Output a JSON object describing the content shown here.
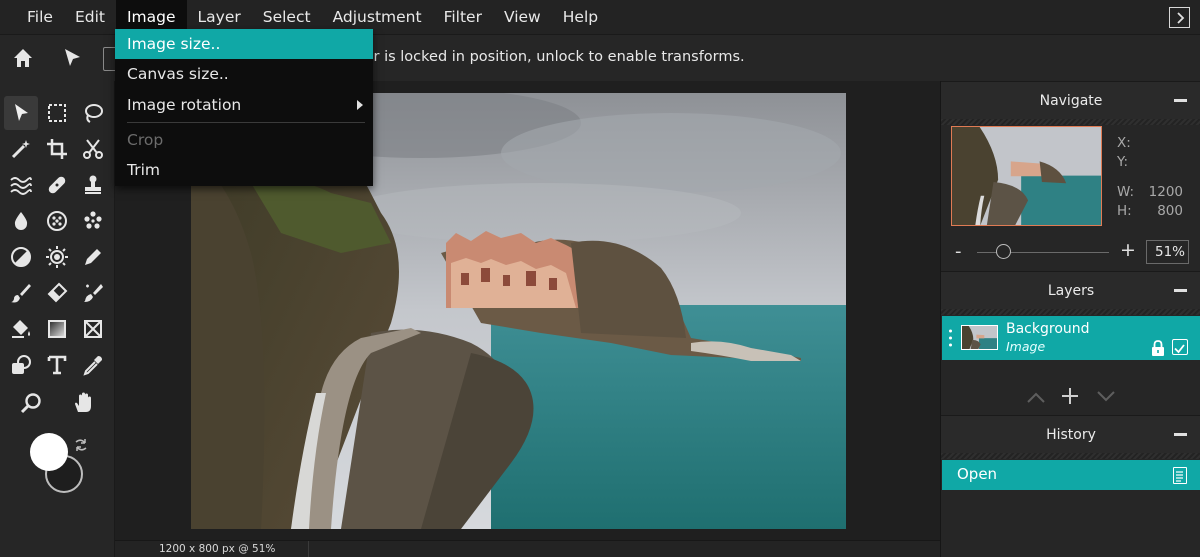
{
  "menu": {
    "items": [
      "File",
      "Edit",
      "Image",
      "Layer",
      "Select",
      "Adjustment",
      "Filter",
      "View",
      "Help"
    ],
    "active": "Image"
  },
  "image_menu": {
    "items": [
      {
        "label": "Image size..",
        "state": "highlighted"
      },
      {
        "label": "Canvas size..",
        "state": "normal"
      },
      {
        "label": "Image rotation",
        "state": "submenu"
      },
      {
        "label": "Crop",
        "state": "disabled"
      },
      {
        "label": "Trim",
        "state": "normal"
      }
    ]
  },
  "options_bar": {
    "message": "yer is locked in position, unlock to enable transforms."
  },
  "tools": [
    "move-tool-icon",
    "marquee-select-icon",
    "lasso-icon",
    "magic-wand-icon",
    "crop-icon",
    "scissors-icon",
    "liquify-icon",
    "healing-bandage-icon",
    "clone-stamp-icon",
    "blur-drop-icon",
    "sponge-icon",
    "dots-pattern-icon",
    "dodge-burn-icon",
    "sun-icon",
    "color-picker-pen-icon",
    "brush-icon",
    "eraser-icon",
    "smudge-brush-icon",
    "paint-bucket-icon",
    "gradient-icon",
    "frame-icon",
    "shape-icon",
    "text-icon",
    "eyedropper-icon",
    "zoom-icon",
    "hand-pan-icon"
  ],
  "colors": {
    "foreground": "#ffffff",
    "background": "#1e1e1e",
    "accent": "#10a8a6"
  },
  "status": {
    "text": "1200 x 800 px @ 51%"
  },
  "navigate": {
    "title": "Navigate",
    "x_label": "X:",
    "y_label": "Y:",
    "w_label": "W:",
    "h_label": "H:",
    "w_value": "1200",
    "h_value": "800",
    "zoom_minus": "-",
    "zoom_plus": "+",
    "zoom": "51%"
  },
  "layers": {
    "title": "Layers",
    "items": [
      {
        "name": "Background",
        "type": "Image"
      }
    ]
  },
  "history": {
    "title": "History",
    "items": [
      "Open"
    ]
  }
}
